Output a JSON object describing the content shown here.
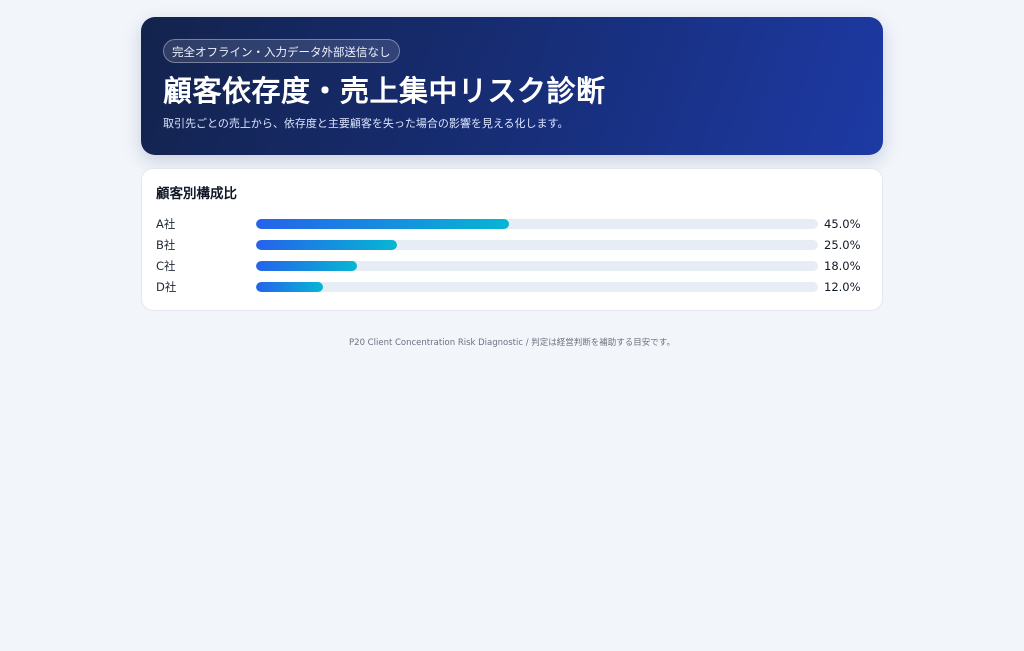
{
  "header": {
    "badge": "完全オフライン・入力データ外部送信なし",
    "title": "顧客依存度・売上集中リスク診断",
    "subtitle": "取引先ごとの売上から、依存度と主要顧客を失った場合の影響を見える化します。"
  },
  "composition": {
    "title": "顧客別構成比",
    "rows": [
      {
        "label": "A社",
        "value": "45.0%",
        "share": 0.45
      },
      {
        "label": "B社",
        "value": "25.0%",
        "share": 0.25
      },
      {
        "label": "C社",
        "value": "18.0%",
        "share": 0.18
      },
      {
        "label": "D社",
        "value": "12.0%",
        "share": 0.12
      }
    ]
  },
  "footer": {
    "text": "P20 Client Concentration Risk Diagnostic / 判定は経営判断を補助する目安です。"
  },
  "colors": {
    "hero_start": "#13234d",
    "hero_end": "#1d3aa5",
    "bar_start": "#2563eb",
    "bar_end": "#06b6d4",
    "track": "#e6edf5",
    "background": "#f2f5fa"
  }
}
